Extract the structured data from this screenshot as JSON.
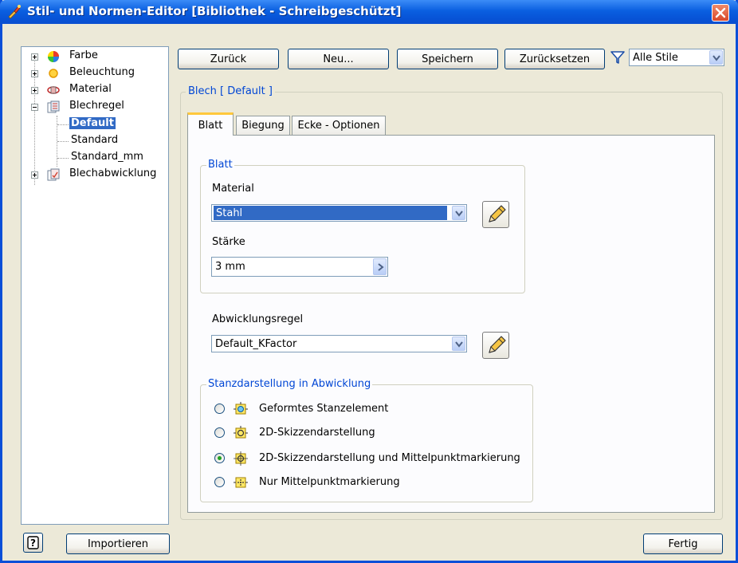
{
  "window": {
    "title": "Stil- und Normen-Editor [Bibliothek - Schreibgeschützt]"
  },
  "tree": {
    "items": [
      {
        "label": "Farbe",
        "expander": "+",
        "icon": "color-wheel-icon"
      },
      {
        "label": "Beleuchtung",
        "expander": "+",
        "icon": "light-bulb-icon"
      },
      {
        "label": "Material",
        "expander": "+",
        "icon": "material-icon"
      },
      {
        "label": "Blechregel",
        "expander": "-",
        "icon": "sheet-rule-icon"
      },
      {
        "label": "Default",
        "selected": true
      },
      {
        "label": "Standard"
      },
      {
        "label": "Standard_mm"
      },
      {
        "label": "Blechabwicklung",
        "expander": "+",
        "icon": "flat-pattern-icon"
      }
    ]
  },
  "toolbar": {
    "back": "Zurück",
    "new": "Neu...",
    "save": "Speichern",
    "reset": "Zurücksetzen",
    "filter_value": "Alle Stile"
  },
  "style": {
    "group_label": "Blech [ Default ]",
    "tabs": [
      "Blatt",
      "Biegung",
      "Ecke - Optionen"
    ],
    "active_tab": "Blatt"
  },
  "sheet": {
    "group_label": "Blatt",
    "material_label": "Material",
    "material_value": "Stahl",
    "thickness_label": "Stärke",
    "thickness_value": "3 mm"
  },
  "unfold": {
    "label": "Abwicklungsregel",
    "value": "Default_KFactor"
  },
  "punch": {
    "group_label": "Stanzdarstellung in Abwicklung",
    "options": [
      {
        "label": "Geformtes Stanzelement",
        "checked": false,
        "icon": "formed-punch-icon"
      },
      {
        "label": "2D-Skizzendarstellung",
        "checked": false,
        "icon": "sketch-punch-icon"
      },
      {
        "label": "2D-Skizzendarstellung und Mittelpunktmarkierung",
        "checked": true,
        "icon": "sketch-center-punch-icon"
      },
      {
        "label": "Nur Mittelpunktmarkierung",
        "checked": false,
        "icon": "center-mark-icon"
      }
    ]
  },
  "footer": {
    "import": "Importieren",
    "done": "Fertig"
  },
  "colors": {
    "title_bar": "#0a5fe0",
    "selection": "#316ac5",
    "group_label": "#0046d5",
    "tab_highlight": "#ffc83c"
  }
}
